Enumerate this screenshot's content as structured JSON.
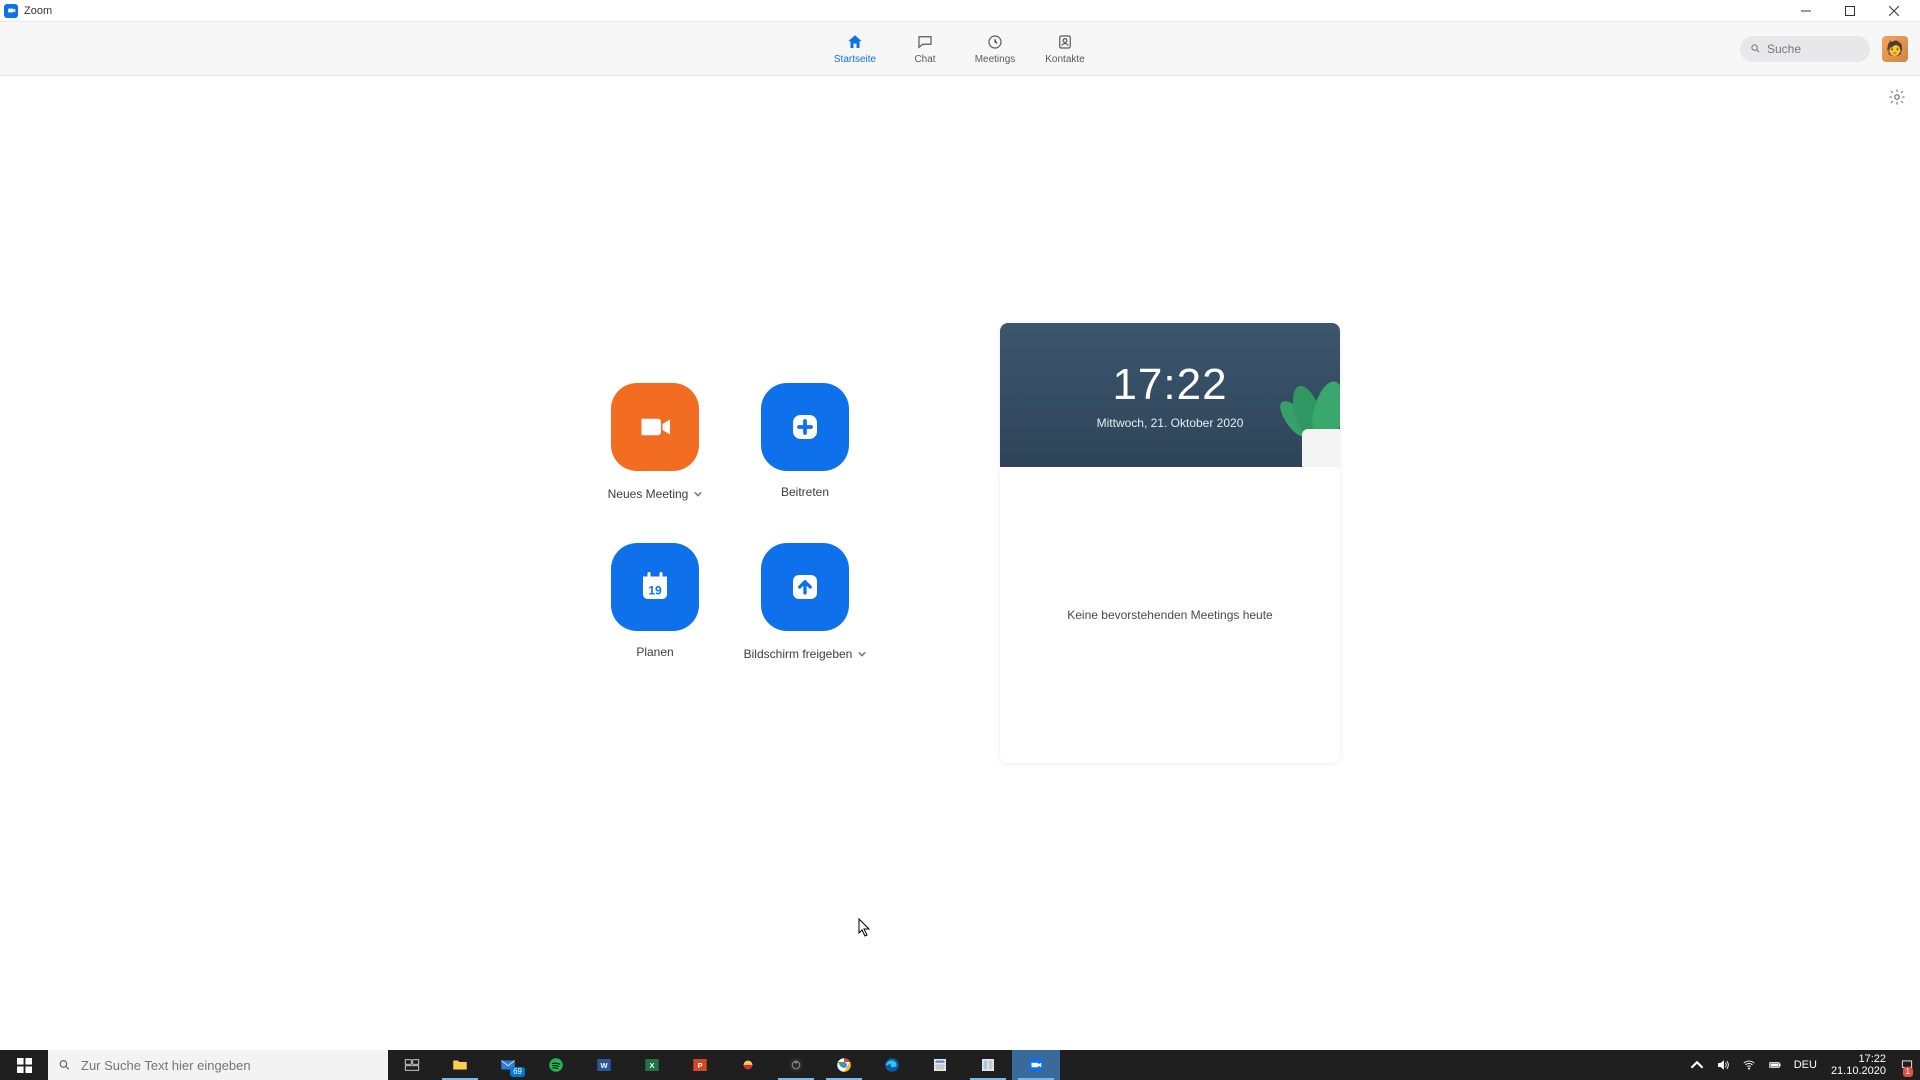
{
  "window": {
    "title": "Zoom"
  },
  "nav": {
    "tabs": [
      {
        "label": "Startseite",
        "icon": "home",
        "active": true
      },
      {
        "label": "Chat",
        "icon": "chat",
        "active": false
      },
      {
        "label": "Meetings",
        "icon": "clock",
        "active": false
      },
      {
        "label": "Kontakte",
        "icon": "contacts",
        "active": false
      }
    ],
    "search_placeholder": "Suche"
  },
  "actions": {
    "new_meeting": "Neues Meeting",
    "join": "Beitreten",
    "schedule": "Planen",
    "schedule_day": "19",
    "share_screen": "Bildschirm freigeben"
  },
  "calendar": {
    "time": "17:22",
    "date": "Mittwoch, 21. Oktober 2020",
    "empty_text": "Keine bevorstehenden Meetings heute"
  },
  "taskbar": {
    "search_placeholder": "Zur Suche Text hier eingeben",
    "mail_badge": "69",
    "keyboard_layout": "DEU",
    "clock_time": "17:22",
    "clock_date": "21.10.2020",
    "notification_badge": "1"
  }
}
